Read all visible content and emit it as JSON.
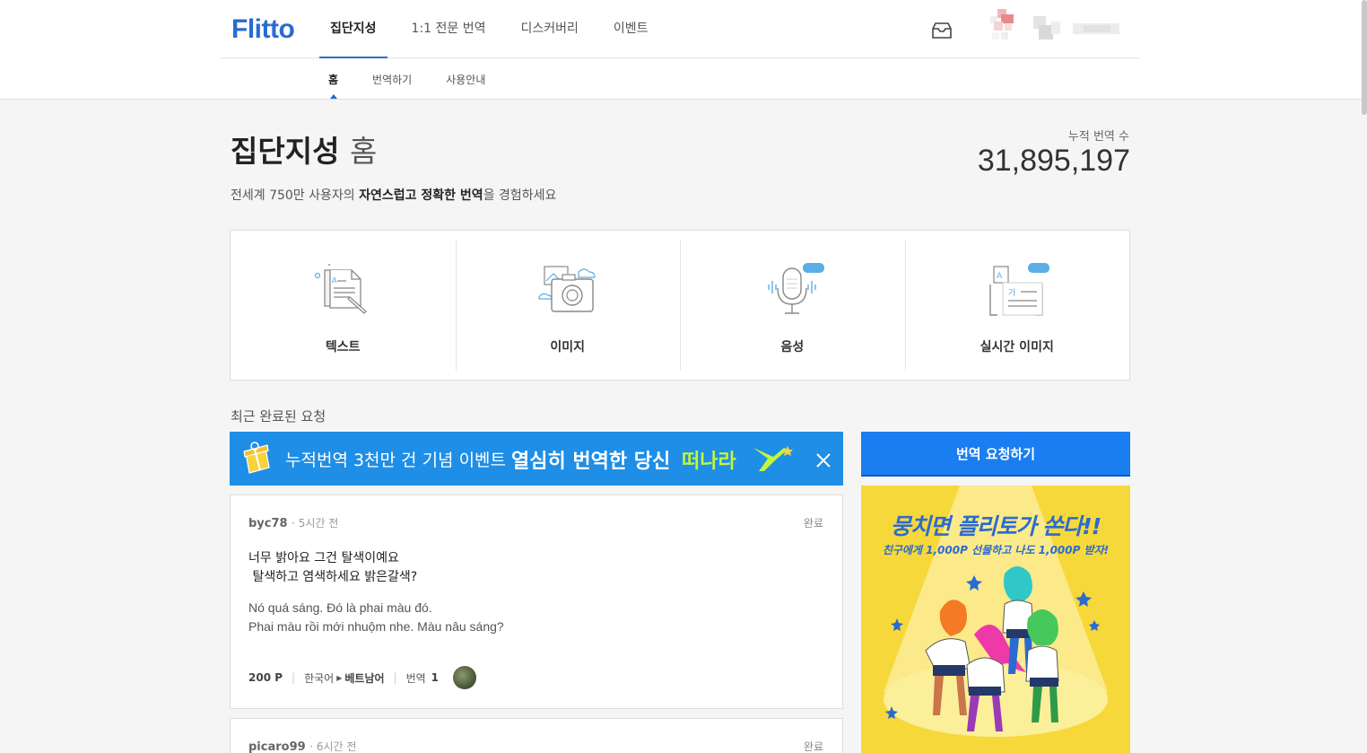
{
  "header": {
    "logo": "Flitto",
    "nav": [
      "집단지성",
      "1:1 전문 번역",
      "디스커버리",
      "이벤트"
    ],
    "subnav": [
      "홈",
      "번역하기",
      "사용안내"
    ]
  },
  "hero": {
    "title_main": "집단지성",
    "title_sub": "홈",
    "tagline_pre": "전세계 750만 사용자의 ",
    "tagline_bold": "자연스럽고 정확한 번역",
    "tagline_post": "을 경험하세요",
    "count_label": "누적 번역 수",
    "count_value": "31,895,197"
  },
  "services": [
    {
      "label": "텍스트",
      "icon": "text-document-icon"
    },
    {
      "label": "이미지",
      "icon": "camera-icon"
    },
    {
      "label": "음성",
      "icon": "microphone-icon",
      "badge": "App"
    },
    {
      "label": "실시간 이미지",
      "icon": "realtime-image-icon",
      "badge": "App"
    }
  ],
  "recent": {
    "title": "최근 완료된 요청"
  },
  "event_banner": {
    "text": "누적번역 3천만 건 기념 이벤트",
    "bold": "열심히 번역한 당신",
    "accent": "떠나라"
  },
  "requests": [
    {
      "user": "byc78",
      "time": "· 5시간 전",
      "status": "완료",
      "source": "너무 밝아요 그건 탈색이예요\n 탈색하고 염색하세요 밝은갈색?",
      "translation": "Nó quá sáng. Đó là phai màu đó.\nPhai màu rồi mới nhuộm nhe. Màu nâu sáng?",
      "points": "200 P",
      "from_lang": "한국어",
      "to_lang": "베트남어",
      "tr_label": "번역",
      "tr_count": "1"
    },
    {
      "user": "picaro99",
      "time": "· 6시간 전",
      "status": "완료"
    }
  ],
  "sidebar": {
    "request_button": "번역 요청하기",
    "promo_title": "뭉치면 플리토가 쏜다!!",
    "promo_sub": "친구에게 1,000P 선물하고 나도 1,000P 받자!"
  },
  "colors": {
    "brand": "#2a6bd1",
    "button": "#1a7ef0",
    "banner": "#1e8ee6",
    "promo_bg": "#f6d83a"
  }
}
